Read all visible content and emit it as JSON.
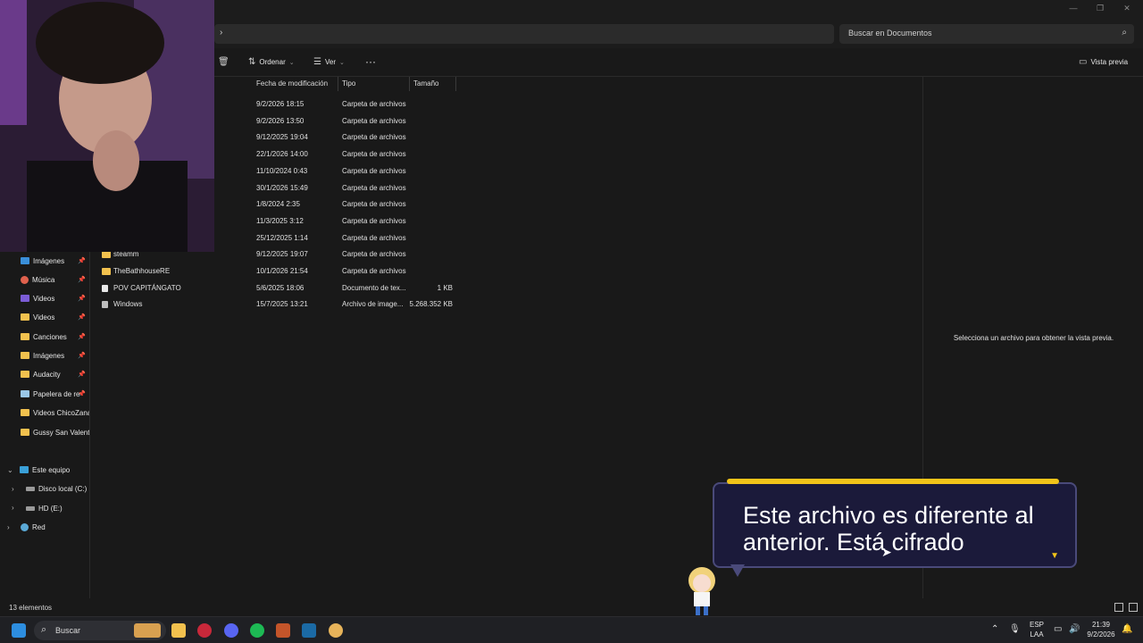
{
  "window": {
    "minimize_icon": "minimize-icon",
    "maximize_icon": "restore-icon",
    "close_icon": "close-icon"
  },
  "address": {
    "search_placeholder": "Buscar en Documentos"
  },
  "toolbar": {
    "sort_label": "Ordenar",
    "view_label": "Ver",
    "more_label": "···",
    "preview_label": "Vista previa"
  },
  "nav": {
    "quick": [
      {
        "label": "Imágenes",
        "icon": "pictures-icon",
        "pinned": true
      },
      {
        "label": "Música",
        "icon": "music-icon",
        "pinned": true
      },
      {
        "label": "Videos",
        "icon": "videos-icon",
        "pinned": true
      },
      {
        "label": "Videos",
        "icon": "folder-icon",
        "pinned": true
      },
      {
        "label": "Canciones",
        "icon": "folder-icon",
        "pinned": true
      },
      {
        "label": "Imágenes",
        "icon": "folder-icon",
        "pinned": true
      },
      {
        "label": "Audacity",
        "icon": "folder-icon",
        "pinned": true
      },
      {
        "label": "Papelera de re",
        "icon": "recycle-bin-icon",
        "pinned": true
      },
      {
        "label": "Videos ChicoZana",
        "icon": "folder-icon",
        "pinned": false
      },
      {
        "label": "Gussy San Valentín",
        "icon": "folder-icon",
        "pinned": false
      }
    ],
    "this_pc": "Este equipo",
    "drives": [
      {
        "label": "Disco local (C:)"
      },
      {
        "label": "HD (E:)"
      }
    ],
    "network": "Red",
    "pin_glyph": "📌"
  },
  "columns": {
    "modified": "Fecha de modificación",
    "type": "Tipo",
    "size": "Tamaño"
  },
  "files": [
    {
      "name": "",
      "modified": "9/2/2026 18:15",
      "type": "Carpeta de archivos",
      "size": "",
      "kind": "folder"
    },
    {
      "name": "",
      "modified": "9/2/2026 13:50",
      "type": "Carpeta de archivos",
      "size": "",
      "kind": "folder"
    },
    {
      "name": "",
      "modified": "9/12/2025 19:04",
      "type": "Carpeta de archivos",
      "size": "",
      "kind": "folder"
    },
    {
      "name": "",
      "modified": "22/1/2026 14:00",
      "type": "Carpeta de archivos",
      "size": "",
      "kind": "folder"
    },
    {
      "name": "",
      "modified": "11/10/2024 0:43",
      "type": "Carpeta de archivos",
      "size": "",
      "kind": "folder"
    },
    {
      "name": "",
      "modified": "30/1/2026 15:49",
      "type": "Carpeta de archivos",
      "size": "",
      "kind": "folder"
    },
    {
      "name": "",
      "modified": "1/8/2024 2:35",
      "type": "Carpeta de archivos",
      "size": "",
      "kind": "folder"
    },
    {
      "name": "",
      "modified": "11/3/2025 3:12",
      "type": "Carpeta de archivos",
      "size": "",
      "kind": "folder"
    },
    {
      "name": "",
      "modified": "25/12/2025 1:14",
      "type": "Carpeta de archivos",
      "size": "",
      "kind": "folder"
    },
    {
      "name": "steamm",
      "modified": "9/12/2025 19:07",
      "type": "Carpeta de archivos",
      "size": "",
      "kind": "folder"
    },
    {
      "name": "TheBathhouseRE",
      "modified": "10/1/2026 21:54",
      "type": "Carpeta de archivos",
      "size": "",
      "kind": "folder"
    },
    {
      "name": "POV CAPITÁNGATO",
      "modified": "5/6/2025 18:06",
      "type": "Documento de tex...",
      "size": "1 KB",
      "kind": "doc"
    },
    {
      "name": "Windows",
      "modified": "15/7/2025 13:21",
      "type": "Archivo de image...",
      "size": "5.268.352 KB",
      "kind": "img"
    }
  ],
  "preview": {
    "message": "Selecciona un archivo para obtener la vista previa."
  },
  "status": {
    "count": "13 elementos"
  },
  "dialog": {
    "text": "Este archivo es diferente al anterior. Está cifrado",
    "accent": "#f2c419"
  },
  "taskbar": {
    "search_label": "Buscar",
    "apps": [
      "windows-start-icon",
      "file-explorer-icon",
      "opera-gx-icon",
      "discord-icon",
      "spotify-icon",
      "game-icon",
      "steam-icon",
      "game-character-icon"
    ],
    "lang_top": "ESP",
    "lang_bottom": "LAA",
    "time": "21:39",
    "date": "9/2/2026"
  }
}
